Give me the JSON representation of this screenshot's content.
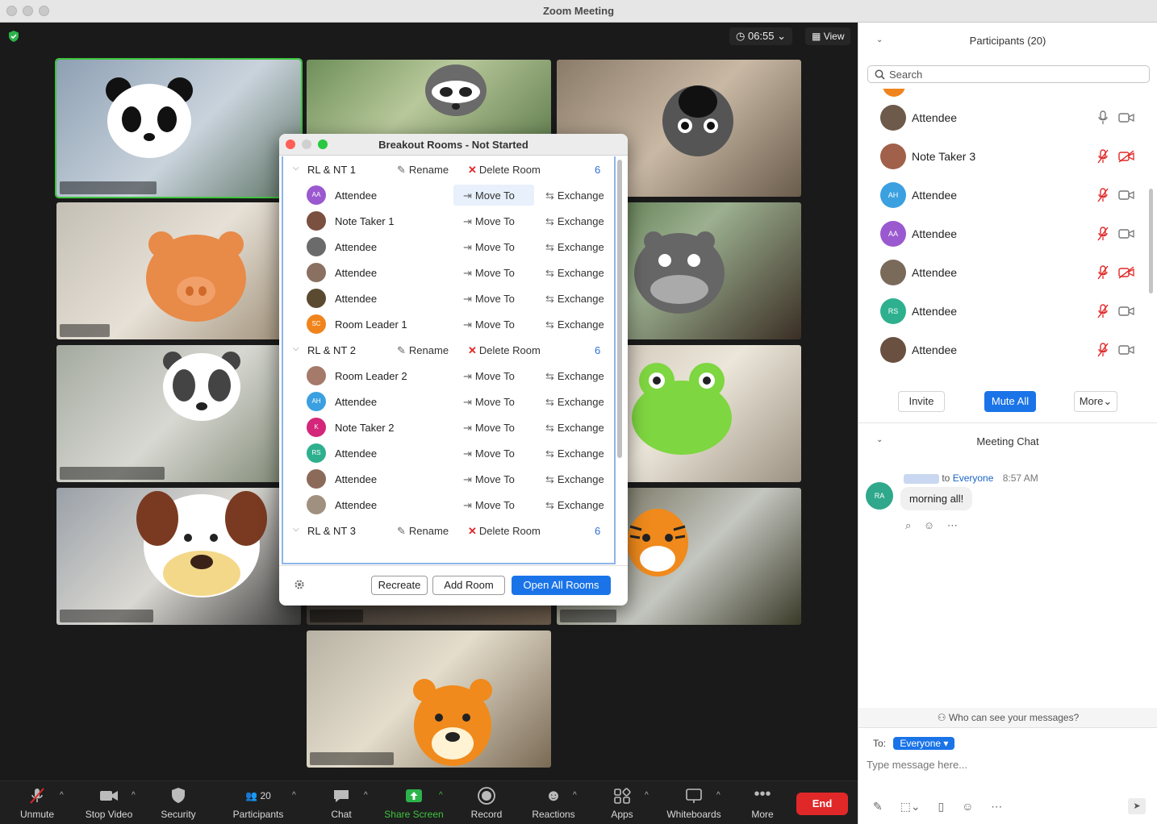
{
  "window": {
    "title": "Zoom Meeting"
  },
  "top_bar": {
    "timer": "06:55",
    "view_label": "View"
  },
  "breakout": {
    "title": "Breakout Rooms - Not Started",
    "rename_label": "Rename",
    "delete_label": "Delete Room",
    "move_label": "Move To",
    "exchange_label": "Exchange",
    "rooms": [
      {
        "name": "RL & NT 1",
        "count": "6",
        "members": [
          {
            "name": "Attendee",
            "initials": "AA",
            "color": "#9b59d0"
          },
          {
            "name": "Note Taker 1",
            "initials": "",
            "color": "#7a5040"
          },
          {
            "name": "Attendee",
            "initials": "",
            "color": "#6b6b6b"
          },
          {
            "name": "Attendee",
            "initials": "",
            "color": "#8a7060"
          },
          {
            "name": "Attendee",
            "initials": "",
            "color": "#5a4a30"
          },
          {
            "name": "Room Leader 1",
            "initials": "SC",
            "color": "#f0841c"
          }
        ]
      },
      {
        "name": "RL & NT 2",
        "count": "6",
        "members": [
          {
            "name": "Room Leader 2",
            "initials": "",
            "color": "#a57a6a"
          },
          {
            "name": "Attendee",
            "initials": "AH",
            "color": "#3aa0e0"
          },
          {
            "name": "Note Taker 2",
            "initials": "K",
            "color": "#d4267a"
          },
          {
            "name": "Attendee",
            "initials": "RS",
            "color": "#2eb08e"
          },
          {
            "name": "Attendee",
            "initials": "",
            "color": "#8c6a5a"
          },
          {
            "name": "Attendee",
            "initials": "",
            "color": "#a09080"
          }
        ]
      },
      {
        "name": "RL & NT 3",
        "count": "6",
        "members": []
      }
    ],
    "footer": {
      "recreate": "Recreate",
      "add_room": "Add Room",
      "open_all": "Open All Rooms"
    }
  },
  "participants": {
    "title": "Participants (20)",
    "search_placeholder": "Search",
    "list": [
      {
        "name": "Attendee",
        "initials": "",
        "color": "#6e5a4a",
        "mic": "on",
        "cam": "on"
      },
      {
        "name": "Note Taker 3",
        "initials": "",
        "color": "#a0604a",
        "mic": "muted",
        "cam": "off"
      },
      {
        "name": "Attendee",
        "initials": "AH",
        "color": "#3aa0e0",
        "mic": "muted",
        "cam": "on"
      },
      {
        "name": "Attendee",
        "initials": "AA",
        "color": "#9b59d0",
        "mic": "muted",
        "cam": "on"
      },
      {
        "name": "Attendee",
        "initials": "",
        "color": "#7a6a5a",
        "mic": "muted",
        "cam": "off"
      },
      {
        "name": "Attendee",
        "initials": "RS",
        "color": "#2eb08e",
        "mic": "muted",
        "cam": "on"
      },
      {
        "name": "Attendee",
        "initials": "",
        "color": "#6a5040",
        "mic": "muted",
        "cam": "on"
      }
    ],
    "buttons": {
      "invite": "Invite",
      "mute_all": "Mute All",
      "more": "More"
    }
  },
  "chat": {
    "title": "Meeting Chat",
    "message": {
      "initials": "RA",
      "to": "to",
      "recipient": "Everyone",
      "time": "8:57 AM",
      "text": "morning all!"
    },
    "who_can_see": "Who can see your messages?",
    "to_label": "To:",
    "to_value": "Everyone",
    "input_placeholder": "Type message here..."
  },
  "toolbar": {
    "unmute": "Unmute",
    "stop_video": "Stop Video",
    "security": "Security",
    "participants": "Participants",
    "participants_count": "20",
    "chat": "Chat",
    "share_screen": "Share Screen",
    "record": "Record",
    "reactions": "Reactions",
    "apps": "Apps",
    "whiteboards": "Whiteboards",
    "more": "More",
    "end": "End"
  },
  "colors": {
    "accent": "#1a74e8",
    "danger": "#e02828",
    "share_green": "#3ec43e"
  }
}
